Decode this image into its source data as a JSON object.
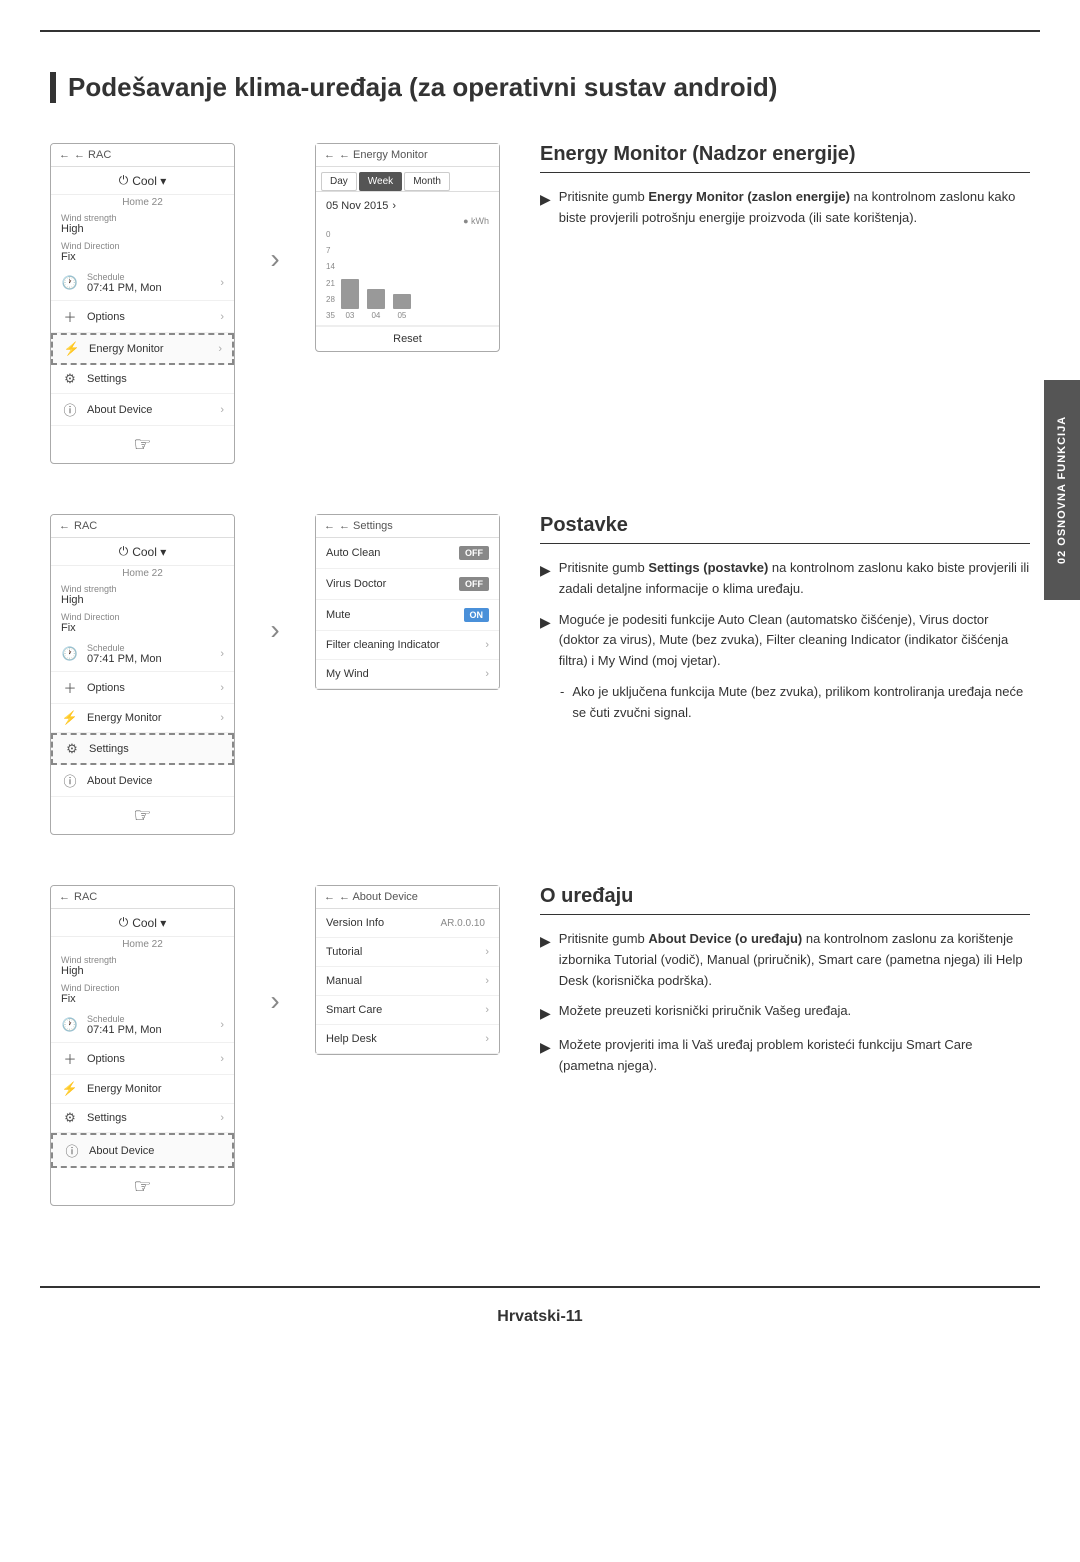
{
  "page": {
    "top_border": true,
    "main_title": "Podešavanje klima-uređaja (za operativni sustav android)",
    "side_tab_text": "02 OSNOVNA FUNKCIJA",
    "footer": "Hrvatski-11"
  },
  "section1": {
    "phone1": {
      "header": "← RAC",
      "mode": "Cool ▾",
      "sub": "Home 22",
      "wind_strength_label": "Wind strength",
      "wind_strength_value": "High",
      "wind_direction_label": "Wind Direction",
      "wind_direction_value": "Fix",
      "schedule_label": "Schedule",
      "schedule_value": "07:41 PM, Mon",
      "options_label": "Options",
      "energy_monitor_label": "Energy Monitor",
      "settings_label": "Settings",
      "about_device_label": "About Device"
    },
    "energy_screen": {
      "header": "← Energy Monitor",
      "tabs": [
        "Day",
        "Week",
        "Month"
      ],
      "active_tab": "Week",
      "date": "05 Nov 2015",
      "kwh_label": "● kWh",
      "y_values": [
        "35",
        "28",
        "21",
        "14",
        "7",
        "0"
      ],
      "bars": [
        {
          "label": "03",
          "height": 30
        },
        {
          "label": "04",
          "height": 22
        },
        {
          "label": "05",
          "height": 18
        }
      ],
      "reset_label": "Reset"
    },
    "title": "Energy Monitor (Nadzor energije)",
    "bullets": [
      "Pritisnite gumb **Energy Monitor (zaslon energije)** na kontrolnom zaslonu kako biste provjerili potrošnju energije proizvoda (ili sate korištenja)."
    ]
  },
  "section2": {
    "settings_screen": {
      "header": "← Settings",
      "rows": [
        {
          "label": "Auto Clean",
          "type": "toggle",
          "value": "OFF"
        },
        {
          "label": "Virus Doctor",
          "type": "toggle",
          "value": "OFF"
        },
        {
          "label": "Mute",
          "type": "toggle",
          "value": "ON"
        },
        {
          "label": "Filter cleaning Indicator",
          "type": "arrow"
        },
        {
          "label": "My Wind",
          "type": "arrow"
        }
      ]
    },
    "title": "Postavke",
    "bullets": [
      "Pritisnite gumb **Settings (postavke)** na kontrolnom zaslonu kako biste provjerili ili zadali detaljne informacije o klima uređaju.",
      "Moguće je podesiti funkcije Auto Clean (automatsko čišćenje), Virus doctor (doktor za virus), Mute (bez zvuka), Filter cleaning Indicator (indikator čišćenja filtra) i My Wind (moj vjetar)."
    ],
    "sub_bullets": [
      "Ako je uključena funkcija Mute (bez zvuka), prilikom kontroliranja uređaja neće se čuti zvučni signal."
    ]
  },
  "section3": {
    "about_screen": {
      "header": "← About Device",
      "rows": [
        {
          "label": "Version Info",
          "value": "AR.0.0.10",
          "type": "value"
        },
        {
          "label": "Tutorial",
          "type": "arrow"
        },
        {
          "label": "Manual",
          "type": "arrow"
        },
        {
          "label": "Smart Care",
          "type": "arrow"
        },
        {
          "label": "Help Desk",
          "type": "arrow"
        }
      ]
    },
    "title": "O uređaju",
    "bullets": [
      "Pritisnite gumb **About Device (o uređaju)** na kontrolnom zaslonu za korištenje izbornika Tutorial (vodič), Manual (priručnik), Smart care (pametna njega) ili Help Desk (korisnička podrška).",
      "Možete preuzeti korisnički priručnik Vašeg uređaja.",
      "Možete provjeriti ima li Vaš uređaj problem koristeći funkciju Smart Care (pametna njega)."
    ]
  }
}
